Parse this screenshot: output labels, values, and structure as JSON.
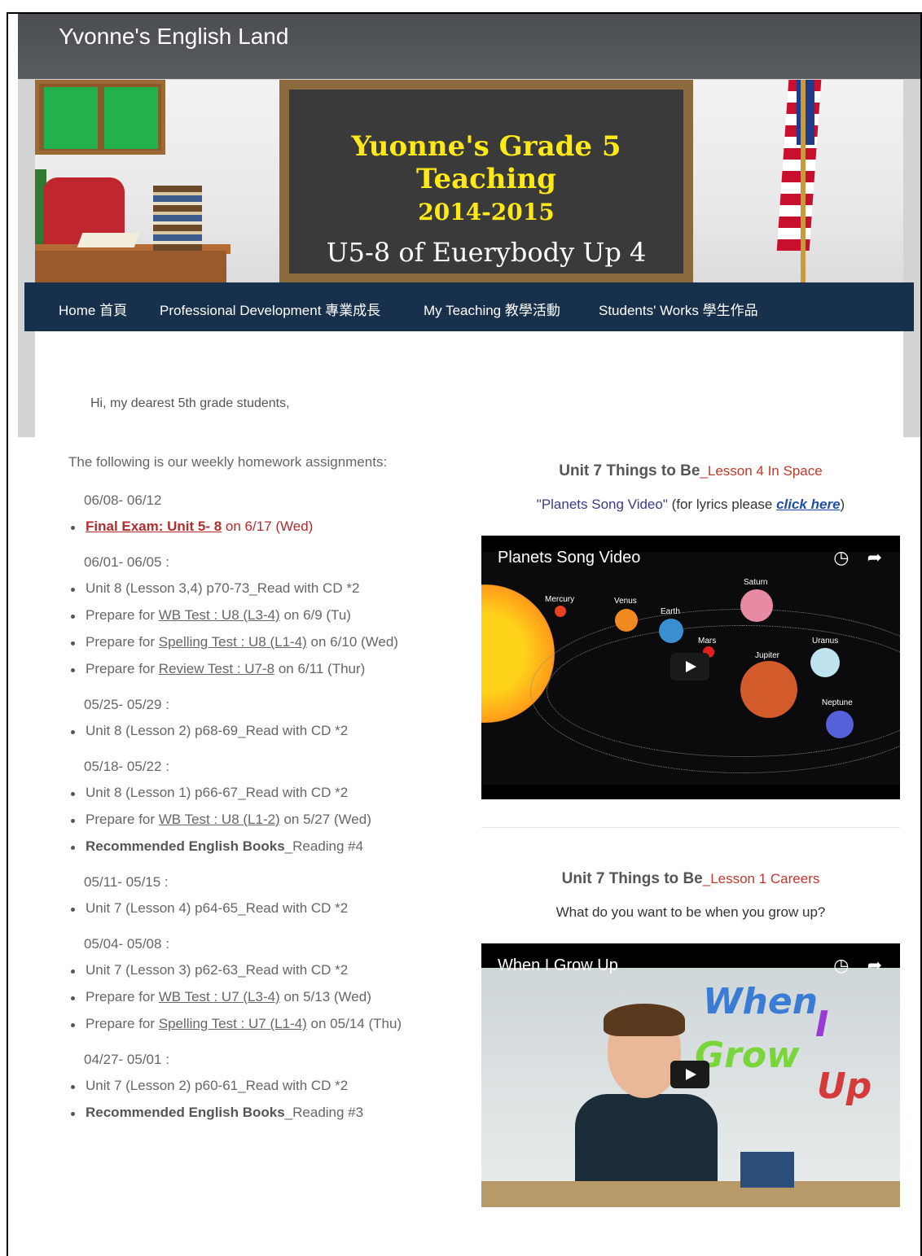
{
  "site": {
    "title": "Yvonne's English Land"
  },
  "banner": {
    "line1": "Yuonne's Grade 5 Teaching",
    "line2": "2014-2015",
    "line3": "U5-8 of Euerybody Up 4"
  },
  "nav": {
    "items": [
      {
        "label": "Home 首頁"
      },
      {
        "label": "Professional Development 專業成長"
      },
      {
        "label": "My Teaching 教學活動"
      },
      {
        "label": "Students' Works 學生作品"
      }
    ]
  },
  "greeting": "Hi, my dearest 5th grade students,",
  "intro": "The following is our weekly homework assignments:",
  "weeks": [
    {
      "date": "06/08- 06/12",
      "items": [
        {
          "link": "Final Exam: Unit 5- 8",
          "rest": " on 6/17 (Wed)"
        }
      ]
    },
    {
      "date": "06/01- 06/05 :",
      "items": [
        {
          "text": "Unit 8 (Lesson 3,4) p70-73_Read with CD *2"
        },
        {
          "prefix": "Prepare for ",
          "link": "WB Test : U8 (L3-4)",
          "rest": "  on 6/9 (Tu)"
        },
        {
          "prefix": "Prepare for ",
          "link": "Spelling Test : U8 (L1-4)",
          "rest": "  on 6/10 (Wed)"
        },
        {
          "prefix": "Prepare for ",
          "link": "Review Test : U7-8",
          "rest": "  on 6/11 (Thur)"
        }
      ]
    },
    {
      "date": "05/25- 05/29 :",
      "items": [
        {
          "text": "Unit 8 (Lesson 2) p68-69_Read with CD *2"
        }
      ]
    },
    {
      "date": "05/18- 05/22 :",
      "items": [
        {
          "text": "Unit 8 (Lesson 1) p66-67_Read with CD *2"
        },
        {
          "prefix": "Prepare for ",
          "link": "WB Test : U8 (L1-2)",
          "rest": "  on 5/27 (Wed)"
        },
        {
          "bold": "Recommended English Books",
          "rest": "_Reading #4"
        }
      ]
    },
    {
      "date": "05/11- 05/15 :",
      "items": [
        {
          "text": "Unit 7 (Lesson 4) p64-65_Read with CD *2"
        }
      ]
    },
    {
      "date": "05/04- 05/08 :",
      "items": [
        {
          "text": "Unit 7 (Lesson 3) p62-63_Read with CD *2"
        },
        {
          "prefix": "Prepare for ",
          "link": "WB Test : U7 (L3-4)",
          "rest": "  on 5/13 (Wed)"
        },
        {
          "prefix": "Prepare for ",
          "link": "Spelling Test : U7 (L1-4)",
          "rest": "  on 05/14 (Thu)"
        }
      ]
    },
    {
      "date": "04/27- 05/01 :",
      "items": [
        {
          "text": "Unit 7 (Lesson 2) p60-61_Read with CD *2"
        },
        {
          "bold": "Recommended English Books",
          "rest": "_Reading #3"
        }
      ]
    }
  ],
  "right": {
    "section1": {
      "heading": "Unit 7  Things to Be",
      "heading_red": "_Lesson 4 In Space",
      "song_label": "\"Planets Song Video\"",
      "lyrics_prefix": "  (for lyrics please ",
      "lyrics_link": "click here",
      "lyrics_suffix": ")",
      "video_title": "Planets Song Video",
      "planets": [
        "Mercury",
        "Venus",
        "Earth",
        "Mars",
        "Jupiter",
        "Saturn",
        "Uranus",
        "Neptune"
      ]
    },
    "section2": {
      "heading": "Unit 7  Things to Be",
      "heading_red": "_Lesson 1 Careers",
      "subline": "What do you want to be when you grow up?",
      "video_title": "When I Grow Up",
      "video_words": [
        "When",
        "I",
        "Grow",
        "Up"
      ]
    }
  },
  "colors": {
    "nav_bg": "#17304b",
    "title_bar": "#4a4e52",
    "accent_red": "#b22c2c",
    "chalk_yellow": "#ffe817"
  },
  "icons": {
    "watch_later": "clock-icon",
    "share": "share-icon",
    "play": "play-icon"
  }
}
